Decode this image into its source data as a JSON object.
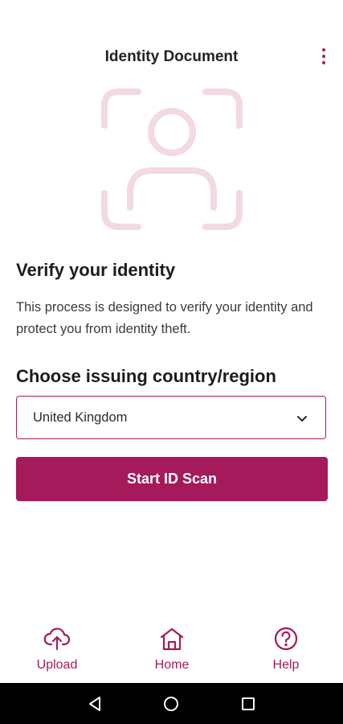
{
  "header": {
    "title": "Identity Document",
    "menu_icon": "more-vertical-icon"
  },
  "hero": {
    "icon": "face-scan-icon",
    "color": "#f2d9e3"
  },
  "verify": {
    "heading": "Verify your identity",
    "description": "This process is designed to verify your identity and protect you from identity theft."
  },
  "country": {
    "heading": "Choose issuing country/region",
    "selected": "United Kingdom",
    "icon": "chevron-down-icon"
  },
  "start_button": {
    "label": "Start ID Scan"
  },
  "bottom_nav": {
    "items": [
      {
        "label": "Upload",
        "icon": "cloud-upload-icon"
      },
      {
        "label": "Home",
        "icon": "home-icon"
      },
      {
        "label": "Help",
        "icon": "help-circle-icon"
      }
    ]
  },
  "system_nav": {
    "icons": [
      "back-icon",
      "home-circle-icon",
      "recents-icon"
    ]
  },
  "colors": {
    "accent": "#a51a5a",
    "hero": "#f2d9e3",
    "system_bar": "#000000"
  }
}
